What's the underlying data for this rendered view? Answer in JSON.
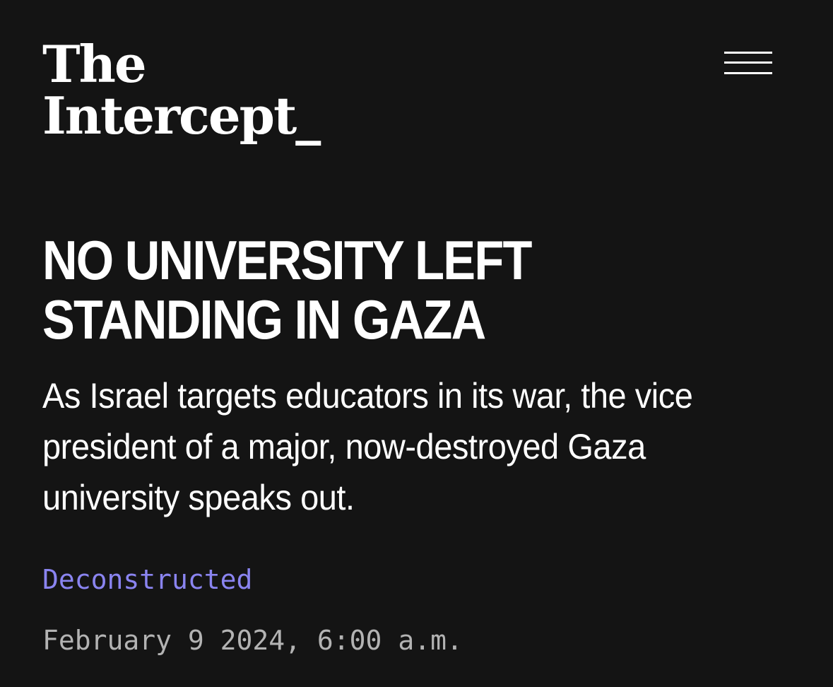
{
  "brand": {
    "logo_line1": "The",
    "logo_line2": "Intercept_"
  },
  "header": {
    "menu_icon": "hamburger-menu-icon"
  },
  "article": {
    "headline": "NO UNIVERSITY LEFT STANDING IN GAZA",
    "dek": "As Israel targets educators in its war, the vice president of a major, now-destroyed Gaza university speaks out.",
    "section": "Deconstructed",
    "date": "February 9 2024, 6:00 a.m."
  },
  "colors": {
    "background": "#141414",
    "text": "#ffffff",
    "section_link": "#8a84f0",
    "date": "#b3b3b3"
  }
}
